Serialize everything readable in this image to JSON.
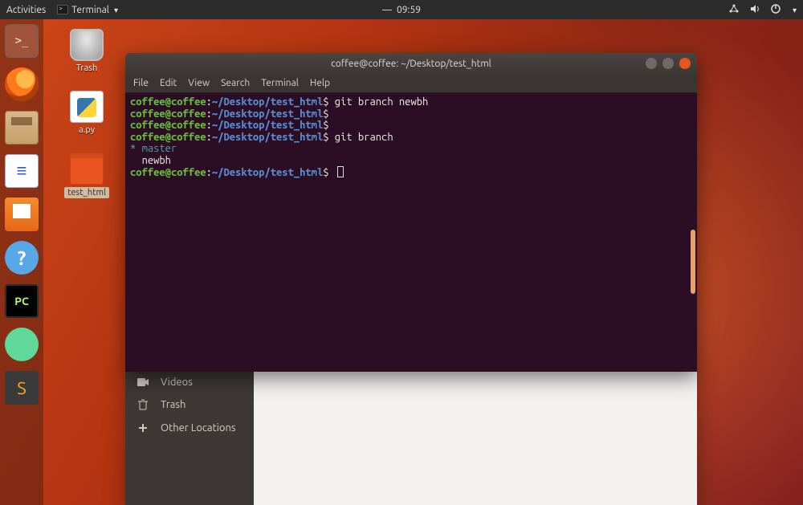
{
  "topbar": {
    "activities": "Activities",
    "app_label": "Terminal",
    "time_prefix": "—",
    "time": "09:59"
  },
  "dock": {
    "terminal": ">_",
    "office": "≡",
    "help": "?",
    "pycharm": "PC",
    "sublime": "S"
  },
  "desktop_icons": {
    "trash": "Trash",
    "apy": "a.py",
    "test_html": "test_html"
  },
  "terminal": {
    "title": "coffee@coffee: ~/Desktop/test_html",
    "menu": {
      "file": "File",
      "edit": "Edit",
      "view": "View",
      "search": "Search",
      "terminal": "Terminal",
      "help": "Help"
    },
    "lines": [
      {
        "user": "coffee@coffee",
        "colon": ":",
        "tilde": "~",
        "path": "/Desktop/test_html",
        "dollar": "$",
        "cmd": " git branch newbh"
      },
      {
        "user": "coffee@coffee",
        "colon": ":",
        "tilde": "~",
        "path": "/Desktop/test_html",
        "dollar": "$",
        "cmd": ""
      },
      {
        "user": "coffee@coffee",
        "colon": ":",
        "tilde": "~",
        "path": "/Desktop/test_html",
        "dollar": "$",
        "cmd": ""
      },
      {
        "user": "coffee@coffee",
        "colon": ":",
        "tilde": "~",
        "path": "/Desktop/test_html",
        "dollar": "$",
        "cmd": " git branch"
      }
    ],
    "branch_star": "*",
    "branch_current": "master",
    "branch_other_prefix": "  ",
    "branch_other": "newbh",
    "prompt_final": {
      "user": "coffee@coffee",
      "colon": ":",
      "tilde": "~",
      "path": "/Desktop/test_html",
      "dollar": "$",
      "cmd": " "
    }
  },
  "files": {
    "items": {
      "videos": "Videos",
      "trash": "Trash",
      "other": "Other Locations"
    }
  }
}
